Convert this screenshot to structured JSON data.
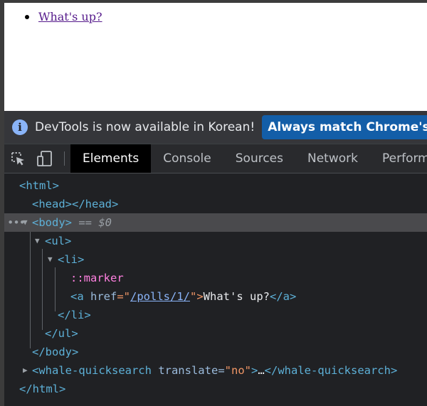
{
  "page": {
    "list_item_link": "What's up?"
  },
  "infobar": {
    "message": "DevTools is now available in Korean!",
    "button": "Always match Chrome's language"
  },
  "toolbar": {
    "tabs": [
      {
        "label": "Elements",
        "active": true
      },
      {
        "label": "Console"
      },
      {
        "label": "Sources"
      },
      {
        "label": "Network"
      },
      {
        "label": "Performance"
      }
    ]
  },
  "dom": {
    "html_open": "<html>",
    "head": "<head></head>",
    "body_open": "<body>",
    "body_eq": "== $0",
    "ul_open": "<ul>",
    "li_open": "<li>",
    "marker": "::marker",
    "a_open_start": "<a ",
    "href_attr": "href",
    "eq_quote": "=\"",
    "href_value": "/polls/1/",
    "close_quote": "\">",
    "a_text": "What's up?",
    "a_close": "</a>",
    "li_close": "</li>",
    "ul_close": "</ul>",
    "body_close": "</body>",
    "whale_open": "<whale-quicksearch ",
    "translate_attr": "translate",
    "translate_eq": "=",
    "translate_value": "\"no\"",
    "whale_gt": ">",
    "whale_ellipsis": "…",
    "whale_close": "</whale-quicksearch>",
    "html_close": "</html>",
    "selected_dots": "•••"
  }
}
